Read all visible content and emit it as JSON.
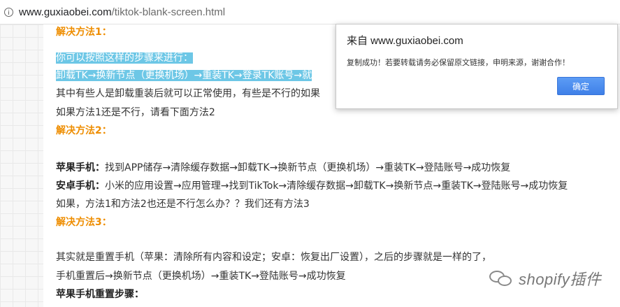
{
  "browser": {
    "url_domain": "www.guxiaobei.com",
    "url_path": "/tiktok-blank-screen.html"
  },
  "article": {
    "method1_heading": "解决方法1：",
    "steps_intro": "你可以按照这样的步骤来进行：",
    "method1_steps": "卸载TK→换新节点（更换机场）→重装TK→登录TK账号→就",
    "note1": "其中有些人是卸载重装后就可以正常使用，有些是不行的如果",
    "note2": "如果方法1还是不行，请看下面方法2",
    "method2_heading": "解决方法2：",
    "apple_label": "苹果手机：",
    "apple_steps": "找到APP储存→清除缓存数据→卸载TK→换新节点（更换机场）→重装TK→登陆账号→成功恢复",
    "android_label": "安卓手机：",
    "android_steps": "小米的应用设置→应用管理→找到TikTok→清除缓存数据→卸载TK→换新节点→重装TK→登陆账号→成功恢复",
    "question": "如果，方法1和方法2也还是不行怎么办？？我们还有方法3",
    "method3_heading": "解决方法3：",
    "reset_desc": "其实就是重置手机（苹果：清除所有内容和设定；安卓：恢复出厂设置），之后的步骤就是一样的了，",
    "reset_steps": "手机重置后→换新节点（更换机场）→重装TK→登陆账号→成功恢复",
    "apple_reset_heading": "苹果手机重置步骤："
  },
  "dialog": {
    "title": "来自 www.guxiaobei.com",
    "message": "复制成功！若要转载请务必保留原文链接，申明来源，谢谢合作！",
    "ok_label": "确定"
  },
  "watermark": {
    "icon": "wechat-icon",
    "text": "shopify插件"
  },
  "colors": {
    "heading": "#ee8d00",
    "highlight": "#6dc7e6",
    "button": "#4a8bf0"
  }
}
